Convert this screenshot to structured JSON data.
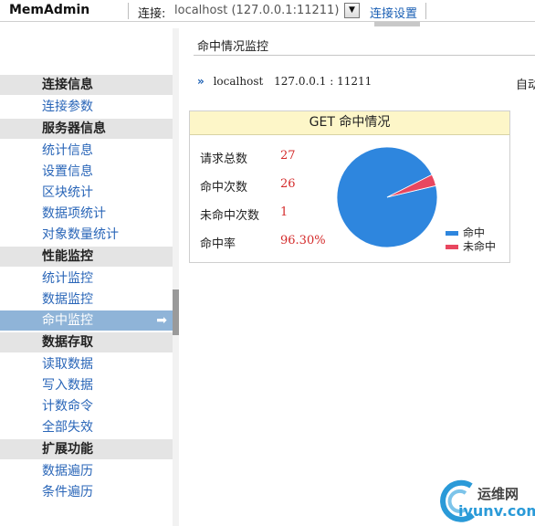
{
  "app": {
    "title": "MemAdmin"
  },
  "topbar": {
    "connection_label": "连接:",
    "connection_value": "localhost (127.0.0.1:11211)",
    "dropdown_glyph": "▼",
    "settings_link": "连接设置"
  },
  "sidebar": {
    "groups": [
      {
        "header": "连接信息",
        "items": [
          "连接参数"
        ]
      },
      {
        "header": "服务器信息",
        "items": [
          "统计信息",
          "设置信息",
          "区块统计",
          "数据项统计",
          "对象数量统计"
        ]
      },
      {
        "header": "性能监控",
        "items": [
          "统计监控",
          "数据监控",
          "命中监控"
        ]
      },
      {
        "header": "数据存取",
        "items": [
          "读取数据",
          "写入数据",
          "计数命令",
          "全部失效"
        ]
      },
      {
        "header": "扩展功能",
        "items": [
          "数据遍历",
          "条件遍历"
        ]
      }
    ],
    "active_item": "命中监控",
    "active_arrow": "➡"
  },
  "main": {
    "panel_title": "命中情况监控",
    "host_icon": "»",
    "host_name": "localhost",
    "host_addr": "127.0.0.1 : 11211",
    "auto_label": "自动"
  },
  "hit_stats": {
    "title": "GET 命中情况",
    "rows": [
      {
        "label": "请求总数",
        "value": "27"
      },
      {
        "label": "命中次数",
        "value": "26"
      },
      {
        "label": "未命中次数",
        "value": "1"
      },
      {
        "label": "命中率",
        "value": "96.30%"
      }
    ]
  },
  "chart_data": {
    "type": "pie",
    "labels": [
      "命中",
      "未命中"
    ],
    "values": [
      26,
      1
    ],
    "colors": [
      "#2e86de",
      "#e8475f"
    ],
    "legend_position": "bottom-right"
  },
  "watermark": {
    "text_top": "运维网",
    "text_bottom": "iyunv.com"
  }
}
